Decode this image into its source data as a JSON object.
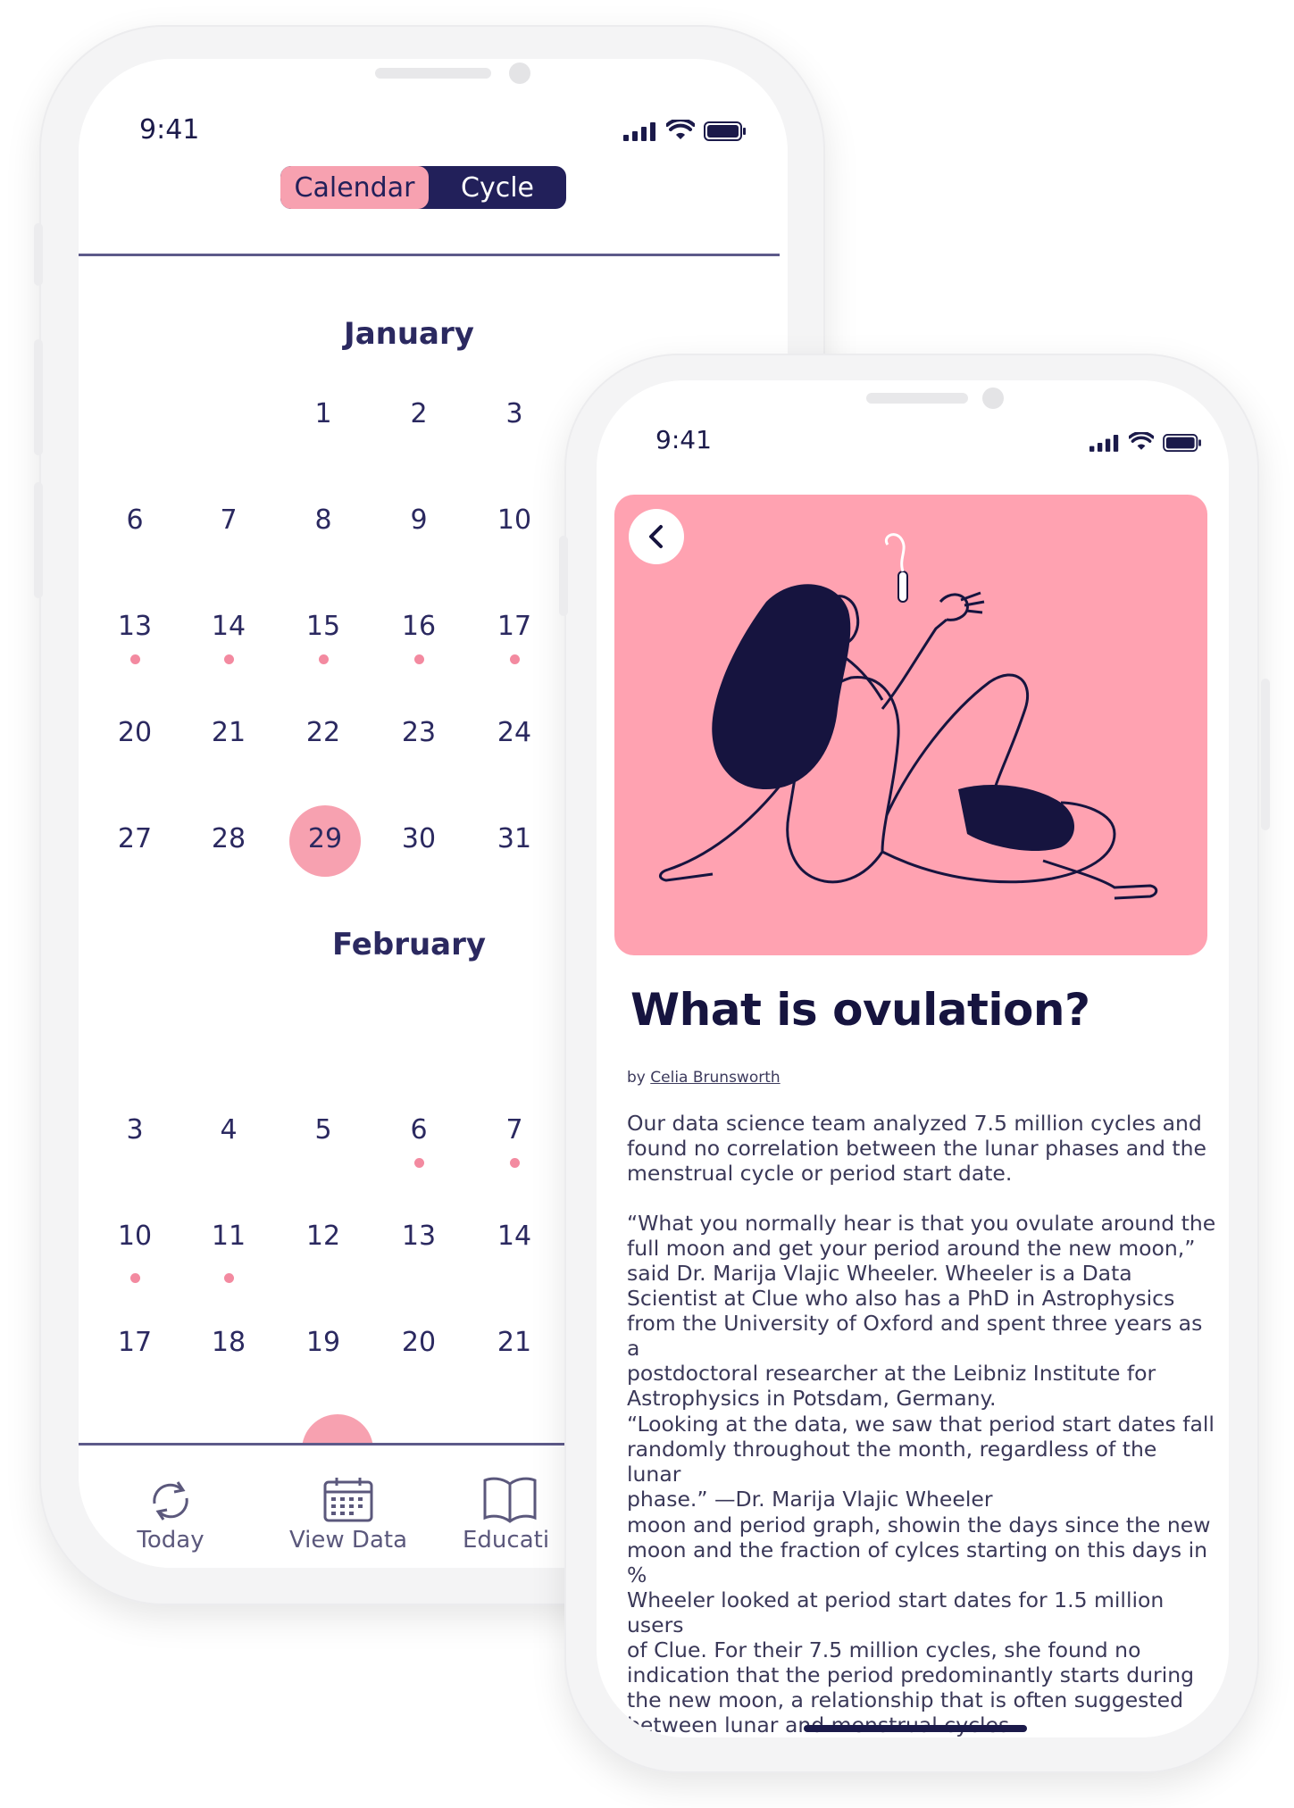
{
  "calendar_phone": {
    "status_time": "9:41",
    "segmented_control": {
      "active": "Calendar",
      "inactive": "Cycle"
    },
    "months": [
      {
        "name": "January",
        "days": [
          "1",
          "2",
          "3",
          "6",
          "7",
          "8",
          "9",
          "10",
          "13",
          "14",
          "15",
          "16",
          "17",
          "20",
          "21",
          "22",
          "23",
          "24",
          "27",
          "28",
          "29",
          "30",
          "31"
        ],
        "marked_days": [
          "13",
          "14",
          "15",
          "16",
          "17"
        ],
        "selected_day": "29"
      },
      {
        "name": "February",
        "days": [
          "3",
          "4",
          "5",
          "6",
          "7",
          "10",
          "11",
          "12",
          "13",
          "14",
          "17",
          "18",
          "19",
          "20",
          "21"
        ],
        "marked_days": [
          "6",
          "7",
          "10",
          "11"
        ]
      }
    ],
    "tabs": [
      {
        "label": "Today",
        "icon": "refresh-icon"
      },
      {
        "label": "View Data",
        "icon": "calendar-icon"
      },
      {
        "label": "Educati",
        "icon": "book-icon"
      }
    ]
  },
  "article_phone": {
    "status_time": "9:41",
    "hero_color": "#ffa2b1",
    "back_icon": "chevron-left-icon",
    "title": "What is ovulation?",
    "byline_prefix": "by",
    "author": "Celia Brunsworth",
    "paragraphs": [
      "Our data science team analyzed 7.5 million cycles and\nfound no correlation between the lunar phases and the\nmenstrual cycle or period start date.",
      "“What you normally hear is that you ovulate around the\nfull moon and get your period around the new moon,”\nsaid Dr. Marija Vlajic Wheeler. Wheeler is a Data\nScientist at Clue who also has a PhD in Astrophysics\nfrom the University of Oxford and spent three years as a\npostdoctoral researcher at the Leibniz Institute for\nAstrophysics in Potsdam, Germany.",
      "“Looking at the data, we saw that period start dates fall\nrandomly throughout the month, regardless of the lunar\nphase.” —Dr. Marija Vlajic Wheeler",
      "moon and period graph, showin the days since the new\nmoon and the fraction of cylces starting on this days in\n%\nWheeler looked at period start dates for 1.5 million users\nof Clue. For their 7.5 million cycles, she found no\nindication that the period predominantly starts during\nthe new moon, a relationship that is often suggested\nbetween lunar and menstrual cycles."
    ]
  },
  "colors": {
    "navy": "#22205a",
    "pink": "#f7a1b0",
    "dot_pink": "#f38aa0"
  }
}
